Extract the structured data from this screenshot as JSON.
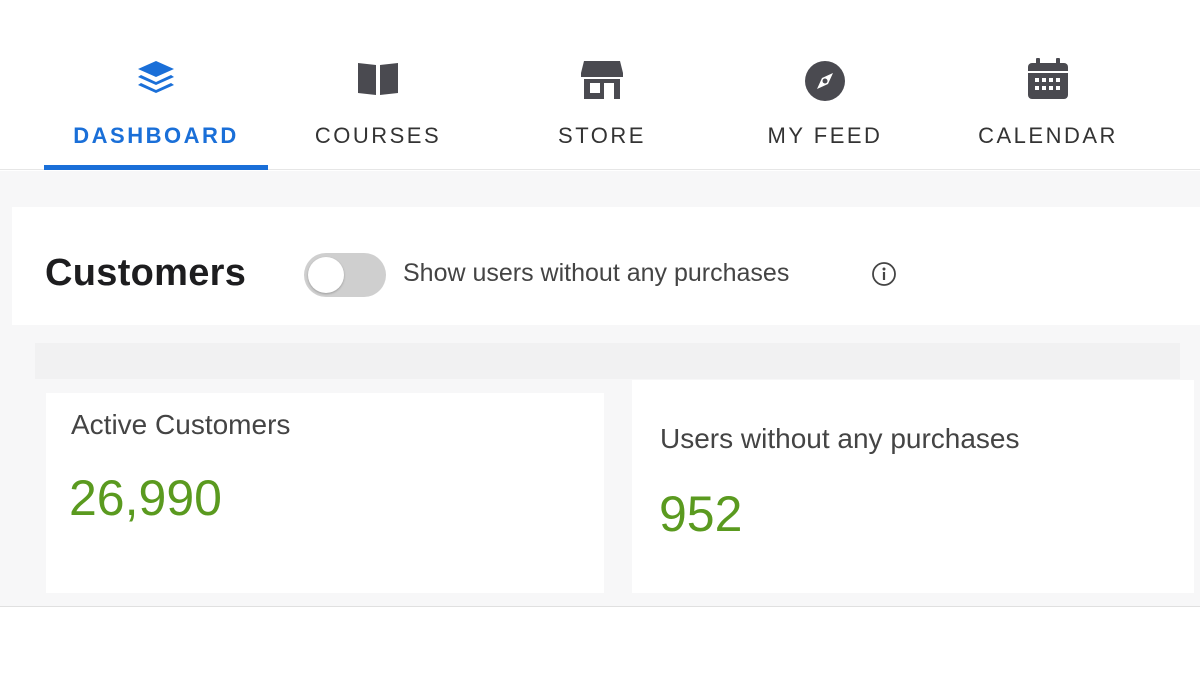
{
  "nav": {
    "tabs": [
      {
        "label": "DASHBOARD",
        "icon": "layers-icon",
        "active": true
      },
      {
        "label": "COURSES",
        "icon": "book-icon",
        "active": false
      },
      {
        "label": "STORE",
        "icon": "store-icon",
        "active": false
      },
      {
        "label": "MY FEED",
        "icon": "compass-icon",
        "active": false
      },
      {
        "label": "CALENDAR",
        "icon": "calendar-icon",
        "active": false
      }
    ],
    "active_color": "#1a6fd8",
    "icon_color": "#4a4a50"
  },
  "customers": {
    "title": "Customers",
    "toggle_label": "Show users without any purchases",
    "toggle_on": false
  },
  "stats": {
    "active": {
      "label": "Active Customers",
      "value": "26,990"
    },
    "no_purchase": {
      "label": "Users without any purchases",
      "value": "952"
    },
    "value_color": "#5a9a1f"
  }
}
